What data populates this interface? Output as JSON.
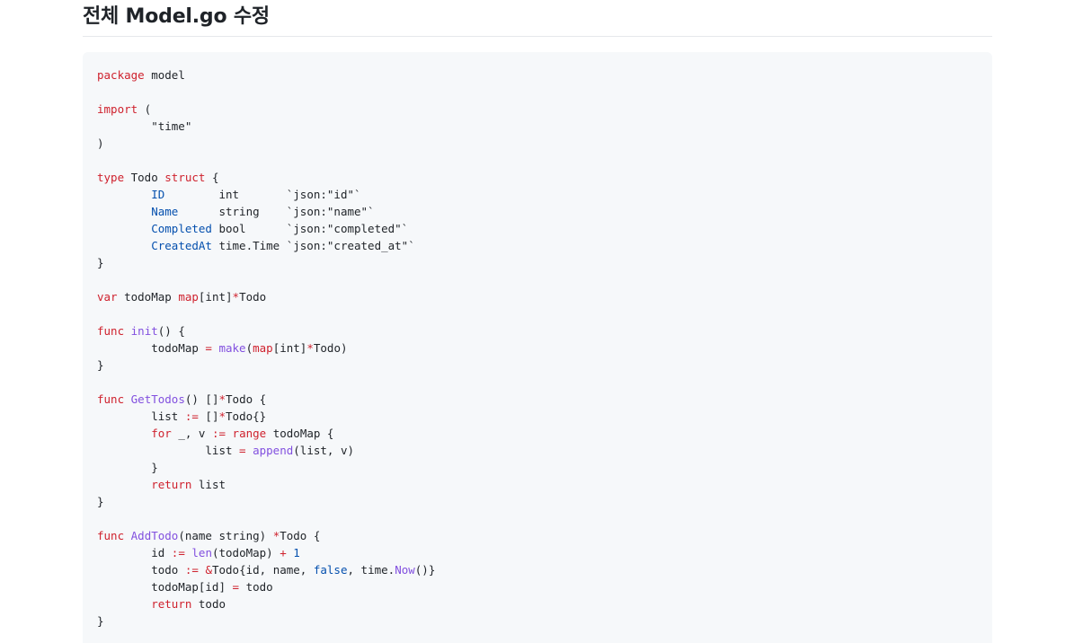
{
  "heading": "전체 Model.go 수정",
  "code": {
    "language": "go",
    "lines": [
      [
        {
          "t": "kw",
          "v": "package"
        },
        {
          "t": "tx",
          "v": " model"
        }
      ],
      [],
      [
        {
          "t": "kw",
          "v": "import"
        },
        {
          "t": "tx",
          "v": " ("
        }
      ],
      [
        {
          "t": "tx",
          "v": "        \"time\""
        }
      ],
      [
        {
          "t": "tx",
          "v": ")"
        }
      ],
      [],
      [
        {
          "t": "kw",
          "v": "type"
        },
        {
          "t": "tx",
          "v": " Todo "
        },
        {
          "t": "kw",
          "v": "struct"
        },
        {
          "t": "tx",
          "v": " {"
        }
      ],
      [
        {
          "t": "tx",
          "v": "        "
        },
        {
          "t": "nm",
          "v": "ID"
        },
        {
          "t": "tx",
          "v": "        int       `json:\"id\"`"
        }
      ],
      [
        {
          "t": "tx",
          "v": "        "
        },
        {
          "t": "nm",
          "v": "Name"
        },
        {
          "t": "tx",
          "v": "      string    `json:\"name\"`"
        }
      ],
      [
        {
          "t": "tx",
          "v": "        "
        },
        {
          "t": "nm",
          "v": "Completed"
        },
        {
          "t": "tx",
          "v": " bool      `json:\"completed\"`"
        }
      ],
      [
        {
          "t": "tx",
          "v": "        "
        },
        {
          "t": "nm",
          "v": "CreatedAt"
        },
        {
          "t": "tx",
          "v": " time.Time `json:\"created_at\"`"
        }
      ],
      [
        {
          "t": "tx",
          "v": "}"
        }
      ],
      [],
      [
        {
          "t": "kw",
          "v": "var"
        },
        {
          "t": "tx",
          "v": " todoMap "
        },
        {
          "t": "kw",
          "v": "map"
        },
        {
          "t": "tx",
          "v": "[int]"
        },
        {
          "t": "kw",
          "v": "*"
        },
        {
          "t": "tx",
          "v": "Todo"
        }
      ],
      [],
      [
        {
          "t": "kw",
          "v": "func"
        },
        {
          "t": "tx",
          "v": " "
        },
        {
          "t": "fn",
          "v": "init"
        },
        {
          "t": "tx",
          "v": "() {"
        }
      ],
      [
        {
          "t": "tx",
          "v": "        todoMap "
        },
        {
          "t": "kw",
          "v": "="
        },
        {
          "t": "tx",
          "v": " "
        },
        {
          "t": "fn",
          "v": "make"
        },
        {
          "t": "tx",
          "v": "("
        },
        {
          "t": "kw",
          "v": "map"
        },
        {
          "t": "tx",
          "v": "[int]"
        },
        {
          "t": "kw",
          "v": "*"
        },
        {
          "t": "tx",
          "v": "Todo)"
        }
      ],
      [
        {
          "t": "tx",
          "v": "}"
        }
      ],
      [],
      [
        {
          "t": "kw",
          "v": "func"
        },
        {
          "t": "tx",
          "v": " "
        },
        {
          "t": "fn",
          "v": "GetTodos"
        },
        {
          "t": "tx",
          "v": "() []"
        },
        {
          "t": "kw",
          "v": "*"
        },
        {
          "t": "tx",
          "v": "Todo {"
        }
      ],
      [
        {
          "t": "tx",
          "v": "        list "
        },
        {
          "t": "kw",
          "v": ":="
        },
        {
          "t": "tx",
          "v": " []"
        },
        {
          "t": "kw",
          "v": "*"
        },
        {
          "t": "tx",
          "v": "Todo{}"
        }
      ],
      [
        {
          "t": "tx",
          "v": "        "
        },
        {
          "t": "kw",
          "v": "for"
        },
        {
          "t": "tx",
          "v": " _, v "
        },
        {
          "t": "kw",
          "v": ":="
        },
        {
          "t": "tx",
          "v": " "
        },
        {
          "t": "kw",
          "v": "range"
        },
        {
          "t": "tx",
          "v": " todoMap {"
        }
      ],
      [
        {
          "t": "tx",
          "v": "                list "
        },
        {
          "t": "kw",
          "v": "="
        },
        {
          "t": "tx",
          "v": " "
        },
        {
          "t": "fn",
          "v": "append"
        },
        {
          "t": "tx",
          "v": "(list, v)"
        }
      ],
      [
        {
          "t": "tx",
          "v": "        }"
        }
      ],
      [
        {
          "t": "tx",
          "v": "        "
        },
        {
          "t": "kw",
          "v": "return"
        },
        {
          "t": "tx",
          "v": " list"
        }
      ],
      [
        {
          "t": "tx",
          "v": "}"
        }
      ],
      [],
      [
        {
          "t": "kw",
          "v": "func"
        },
        {
          "t": "tx",
          "v": " "
        },
        {
          "t": "fn",
          "v": "AddTodo"
        },
        {
          "t": "tx",
          "v": "(name string) "
        },
        {
          "t": "kw",
          "v": "*"
        },
        {
          "t": "tx",
          "v": "Todo {"
        }
      ],
      [
        {
          "t": "tx",
          "v": "        id "
        },
        {
          "t": "kw",
          "v": ":="
        },
        {
          "t": "tx",
          "v": " "
        },
        {
          "t": "fn",
          "v": "len"
        },
        {
          "t": "tx",
          "v": "(todoMap) "
        },
        {
          "t": "kw",
          "v": "+"
        },
        {
          "t": "tx",
          "v": " "
        },
        {
          "t": "nm",
          "v": "1"
        }
      ],
      [
        {
          "t": "tx",
          "v": "        todo "
        },
        {
          "t": "kw",
          "v": ":="
        },
        {
          "t": "tx",
          "v": " "
        },
        {
          "t": "kw",
          "v": "&"
        },
        {
          "t": "tx",
          "v": "Todo{id, name, "
        },
        {
          "t": "nm",
          "v": "false"
        },
        {
          "t": "tx",
          "v": ", time."
        },
        {
          "t": "fn",
          "v": "Now"
        },
        {
          "t": "tx",
          "v": "()}"
        }
      ],
      [
        {
          "t": "tx",
          "v": "        todoMap[id] "
        },
        {
          "t": "kw",
          "v": "="
        },
        {
          "t": "tx",
          "v": " todo"
        }
      ],
      [
        {
          "t": "tx",
          "v": "        "
        },
        {
          "t": "kw",
          "v": "return"
        },
        {
          "t": "tx",
          "v": " todo"
        }
      ],
      [
        {
          "t": "tx",
          "v": "}"
        }
      ]
    ]
  },
  "colors": {
    "keyword": "#cf222e",
    "identifier": "#0550ae",
    "function": "#8250df",
    "text": "#1f2328",
    "code_background": "#f6f8fa"
  }
}
